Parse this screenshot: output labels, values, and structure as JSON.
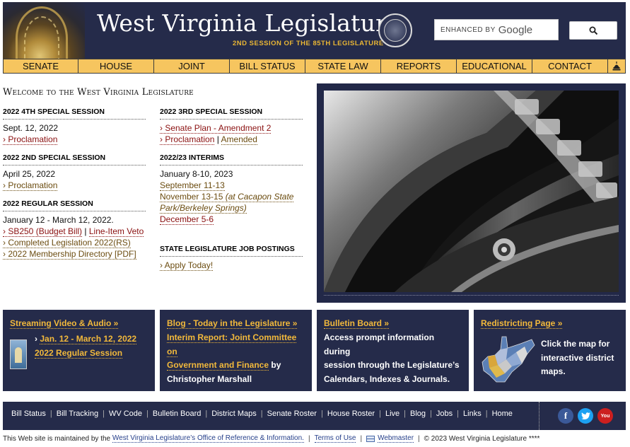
{
  "header": {
    "title": "West Virginia Legislature",
    "subtitle": "2ND SESSION OF THE 85TH LEGISLATURE",
    "search_enhanced": "ENHANCED BY",
    "search_google": "Google"
  },
  "nav": [
    {
      "label": "SENATE"
    },
    {
      "label": "HOUSE"
    },
    {
      "label": "JOINT"
    },
    {
      "label": "BILL STATUS"
    },
    {
      "label": "STATE LAW"
    },
    {
      "label": "REPORTS"
    },
    {
      "label": "EDUCATIONAL"
    },
    {
      "label": "CONTACT"
    }
  ],
  "welcome": "Welcome to the West Virginia Legislature",
  "left": {
    "s1": {
      "title": "2022 4TH SPECIAL SESSION",
      "date": "Sept. 12, 2022",
      "link": "› Proclamation"
    },
    "s2": {
      "title": "2022 2ND SPECIAL SESSION",
      "date": "April 25, 2022",
      "link": "› Proclamation"
    },
    "s3": {
      "title": "2022 REGULAR SESSION",
      "date": "January 12 - March 12, 2022.",
      "link1": "› SB250 (Budget Bill)",
      "link1b": "Line-Item Veto",
      "link2": "› Completed Legislation 2022(RS)",
      "link3": "› 2022 Membership Directory [PDF]"
    }
  },
  "right": {
    "s1": {
      "title": "2022 3RD SPECIAL SESSION",
      "link1": "› Senate Plan - Amendment 2",
      "link2": "› Proclamation",
      "link2b": "Amended"
    },
    "s2": {
      "title": "2022/23 INTERIMS",
      "date": "January 8-10, 2023",
      "link1": "September 11-13",
      "link2": "November 13-15",
      "link2_note": "(at Cacapon State",
      "link2_note2": "Park/Berkeley Springs)",
      "link3": "December 5-6"
    },
    "s3": {
      "title": "STATE LEGISLATURE JOB POSTINGS",
      "link": "› Apply Today!"
    }
  },
  "sep": "|",
  "boxes": {
    "video": {
      "title": "Streaming Video & Audio »",
      "link1": "Jan. 12 - March 12, 2022",
      "link2": "2022 Regular Session",
      "arrow": "›"
    },
    "blog": {
      "title": "Blog - Today in the Legislature »",
      "link1": "Interim Report: Joint Committee on",
      "link2": "Government and Finance",
      "by": " by",
      "author": "Christopher Marshall"
    },
    "bulletin": {
      "title": "Bulletin Board »",
      "line1": "Access prompt information during",
      "line2": "session through the Legislature’s",
      "line3": "Calendars, Indexes & Journals."
    },
    "redistrict": {
      "title": "Redistricting Page »",
      "line1": "Click the map for",
      "line2": "interactive district",
      "line3": "maps."
    }
  },
  "footer": {
    "links": [
      "Bill Status",
      "Bill Tracking",
      "WV Code",
      "Bulletin Board",
      "District Maps",
      "Senate Roster",
      "House Roster",
      "Live",
      "Blog",
      "Jobs",
      "Links",
      "Home"
    ],
    "youtube": "You"
  },
  "bottom": {
    "prefix": "This Web site is maintained by the",
    "office": "West Virginia Legislature’s Office of Reference & Information.",
    "terms": "Terms of Use",
    "webmaster": "Webmaster",
    "copyright": "© 2023 West Virginia Legislature ****"
  },
  "colors": {
    "navy": "#252b4a",
    "gold": "#f6c55f",
    "accent": "#f2b93b",
    "link_red": "#8a1010"
  }
}
